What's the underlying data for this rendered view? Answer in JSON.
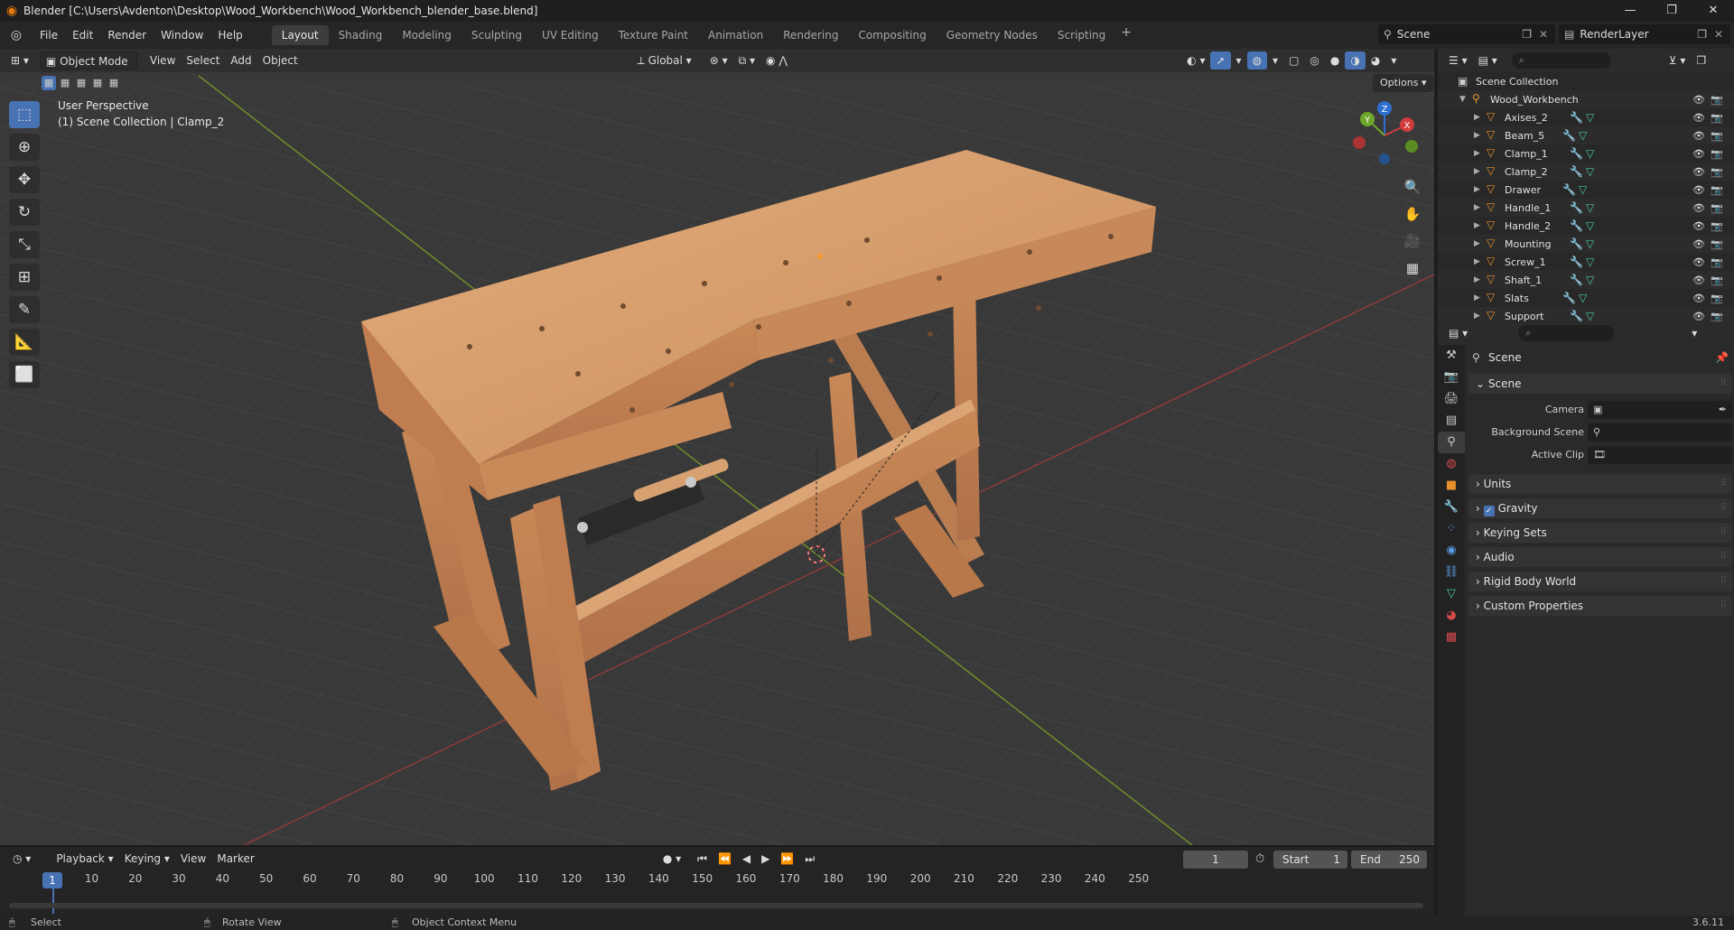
{
  "titlebar": {
    "title": "Blender [C:\\Users\\Avdenton\\Desktop\\Wood_Workbench\\Wood_Workbench_blender_base.blend]",
    "minimize": "—",
    "maximize": "❐",
    "close": "✕"
  },
  "menus": [
    "File",
    "Edit",
    "Render",
    "Window",
    "Help"
  ],
  "workspaces": [
    "Layout",
    "Shading",
    "Modeling",
    "Sculpting",
    "UV Editing",
    "Texture Paint",
    "Animation",
    "Rendering",
    "Compositing",
    "Geometry Nodes",
    "Scripting"
  ],
  "active_workspace": "Layout",
  "scene_name": "Scene",
  "render_layer": "RenderLayer",
  "viewport": {
    "mode": "Object Mode",
    "menus": [
      "View",
      "Select",
      "Add",
      "Object"
    ],
    "transform_orientation": "Global",
    "options_label": "Options",
    "perspective_label": "User Perspective",
    "collection_label": "(1) Scene Collection | Clamp_2",
    "gizmo_axes": {
      "x": "X",
      "y": "Y",
      "z": "Z"
    }
  },
  "timeline": {
    "menus": [
      "Playback",
      "Keying",
      "View",
      "Marker"
    ],
    "current_frame": "1",
    "start_label": "Start",
    "start_value": "1",
    "end_label": "End",
    "end_value": "250",
    "ruler_ticks": [
      "10",
      "20",
      "30",
      "40",
      "50",
      "60",
      "70",
      "80",
      "90",
      "100",
      "110",
      "120",
      "130",
      "140",
      "150",
      "160",
      "170",
      "180",
      "190",
      "200",
      "210",
      "220",
      "230",
      "240",
      "250"
    ],
    "playhead_label": "1"
  },
  "statusbar": {
    "select": "Select",
    "rotate": "Rotate View",
    "context": "Object Context Menu",
    "version": "3.6.11"
  },
  "outliner": {
    "root": "Scene Collection",
    "collection": "Wood_Workbench",
    "objects": [
      "Axises_2",
      "Beam_5",
      "Clamp_1",
      "Clamp_2",
      "Drawer",
      "Handle_1",
      "Handle_2",
      "Mounting",
      "Screw_1",
      "Shaft_1",
      "Slats",
      "Support"
    ]
  },
  "properties": {
    "context_title": "Scene",
    "panel_scene": "Scene",
    "camera_label": "Camera",
    "background_scene_label": "Background Scene",
    "active_clip_label": "Active Clip",
    "panels": [
      "Units",
      "Gravity",
      "Keying Sets",
      "Audio",
      "Rigid Body World",
      "Custom Properties"
    ]
  }
}
